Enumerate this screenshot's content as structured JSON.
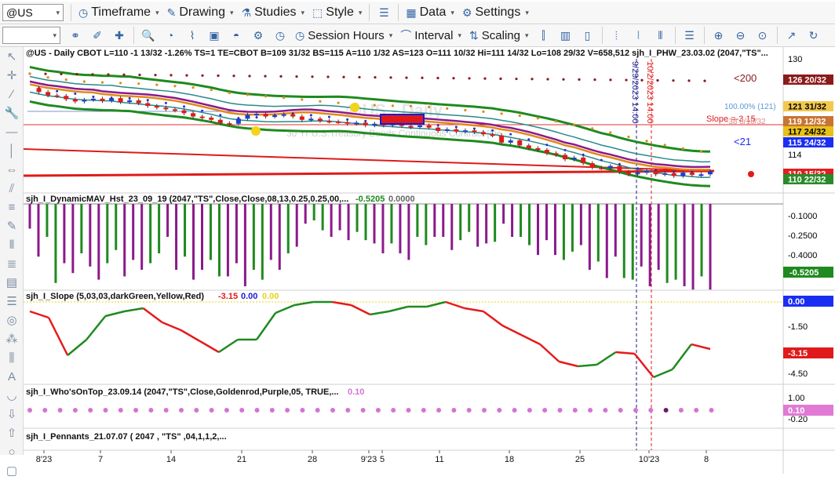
{
  "toolbar1": {
    "symbol": "@US",
    "items": [
      {
        "name": "timeframe",
        "label": "Timeframe",
        "icon": "clock-icon"
      },
      {
        "name": "drawing",
        "label": "Drawing",
        "icon": "pencil-icon"
      },
      {
        "name": "studies",
        "label": "Studies",
        "icon": "flask-icon"
      },
      {
        "name": "style",
        "label": "Style",
        "icon": "style-icon"
      },
      {
        "name": "data",
        "label": "Data",
        "icon": "data-icon"
      },
      {
        "name": "settings",
        "label": "Settings",
        "icon": "gear-icon"
      }
    ]
  },
  "toolbar2": {
    "session_label": "Session Hours",
    "interval_label": "Interval",
    "scaling_label": "Scaling"
  },
  "price_panel": {
    "header": "@US - Daily  CBOT  L=110  -1 13/32  -1.26%  TS=1  TE=CBOT  B=109 31/32  BS=115  A=110 1/32  AS=123  O=111 10/32  Hi=111 14/32  Lo=108 29/32  V=658,512  sjh_I_PHW_23.03.02 (2047,\"TS\"...",
    "watermark_symbol": "@US - Daily",
    "watermark": "30 Yr U.S.Treasury Bonds Continuous Contract [De...",
    "annot_200": "<200",
    "annot_21": "<21",
    "annot_slope": "Slope =-3.15",
    "annot_pct": "100.00% (121)",
    "annot_small": "-38 8/18/32",
    "vline1": "9/29/2023 14:00",
    "vline2": "10/2/2023 14:00",
    "axis_ticks": [
      "130",
      "114"
    ],
    "labels": [
      {
        "text": "126 20/32",
        "color": "#8b1a1a",
        "fg": "#ffffff"
      },
      {
        "text": "121 31/32",
        "color": "#f2c94c",
        "fg": "#000000"
      },
      {
        "text": "119 12/32",
        "color": "#c87533",
        "fg": "#ffffff"
      },
      {
        "text": "117 24/32",
        "color": "#e8c21a",
        "fg": "#000000"
      },
      {
        "text": "115 24/32",
        "color": "#1a2ef2",
        "fg": "#ffffff"
      },
      {
        "text": "110 15/32",
        "color": "#e02020",
        "fg": "#ffffff"
      },
      {
        "text": "110 22/32",
        "color": "#2a8a2a",
        "fg": "#ffffff"
      }
    ]
  },
  "dmav_panel": {
    "header": "sjh_I_DynamicMAV_Hst_23_09_19 (2047,\"TS\",Close,Close,08,13,0.25,0.25,00,...",
    "value1": "-0.5205",
    "value2": "0.0000",
    "axis_ticks": [
      "-0.1000",
      "-0.2500",
      "-0.4000"
    ],
    "label": "-0.5205",
    "values": [
      -0.15,
      -0.32,
      -0.2,
      -0.48,
      -0.36,
      -0.42,
      -0.3,
      -0.38,
      -0.46,
      -0.36,
      -0.28,
      -0.44,
      -0.34,
      -0.4,
      -0.36,
      -0.3,
      -0.2,
      -0.4,
      -0.32,
      -0.46,
      -0.4,
      -0.34,
      -0.44,
      -0.44,
      -0.36,
      -0.5,
      -0.4,
      -0.46,
      -0.34,
      -0.4,
      -0.3,
      -0.26,
      -0.12,
      -0.1,
      -0.16,
      -0.2,
      -0.16,
      -0.22,
      -0.17,
      -0.22,
      -0.24,
      -0.3,
      -0.24,
      -0.3,
      -0.34,
      -0.2,
      -0.25,
      -0.2,
      -0.2,
      -0.28,
      -0.22,
      -0.17,
      -0.26,
      -0.24,
      -0.23,
      -0.12,
      -0.2,
      -0.2,
      -0.25,
      -0.31,
      -0.22,
      -0.31,
      -0.34,
      -0.29,
      -0.25,
      -0.4,
      -0.35,
      -0.45,
      -0.32,
      -0.45,
      -0.46,
      -0.38,
      -0.5,
      -0.4,
      -0.48,
      -0.46,
      -0.5,
      -0.52,
      -0.44,
      -0.52
    ]
  },
  "slope_panel": {
    "header": "sjh_I_Slope (5,03,03,darkGreen,Yellow,Red)",
    "value1": "-3.15",
    "value2": "0.00",
    "value3": "0.00",
    "axis_ticks": [
      "-1.50",
      "-3.00",
      "-4.50"
    ],
    "label_top": "0.00",
    "label_val": "-3.15",
    "values": [
      -0.6,
      -1.0,
      -3.4,
      -2.4,
      -0.9,
      -0.6,
      -0.4,
      -1.3,
      -1.8,
      -2.5,
      -3.2,
      -2.4,
      -2.4,
      -0.7,
      -0.2,
      0.0,
      0.0,
      -0.2,
      -0.8,
      -0.6,
      -0.3,
      -0.3,
      0.0,
      -0.4,
      -0.6,
      -1.5,
      -2.1,
      -2.7,
      -3.8,
      -4.1,
      -4.0,
      -3.2,
      -3.3,
      -4.8,
      -4.3,
      -2.7,
      -3.0
    ]
  },
  "who_panel": {
    "header": "sjh_I_Who'sOnTop_23.09.14 (2047,\"TS\",Close,Goldenrod,Purple,05,  TRUE,...",
    "value": "0.10",
    "axis_ticks": [
      "1.00",
      "-0.20"
    ],
    "label": "0.10"
  },
  "pennants_panel": {
    "header": "sjh_I_Pennants_21.07.07 (  2047  , \"TS\" ,04,1,1,2,..."
  },
  "x_axis": [
    "8'23",
    "7",
    "14",
    "21",
    "28",
    "9'23",
    "5",
    "11",
    "18",
    "25",
    "10'23",
    "8"
  ],
  "colors": {
    "up_candle": "#1a3fd4",
    "down_candle": "#e01a1a",
    "green": "#1f8a1f",
    "purple": "#8b1a8b",
    "red": "#e61a1a",
    "teal": "#2a8a8a",
    "orange": "#e08a1a"
  },
  "price_data": {
    "closes": [
      125.3,
      124.6,
      124.0,
      123.9,
      123.3,
      122.9,
      123.2,
      123.4,
      123.0,
      123.5,
      122.8,
      123.1,
      122.6,
      122.1,
      121.8,
      121.5,
      121.3,
      120.8,
      120.2,
      120.0,
      119.6,
      119.0,
      118.9,
      119.8,
      120.5,
      120.7,
      120.2,
      120.4,
      120.6,
      120.2,
      119.6,
      119.8,
      119.4,
      119.3,
      119.2,
      118.9,
      119.1,
      118.6,
      118.9,
      118.6,
      118.9,
      118.5,
      118.3,
      118.6,
      118.2,
      117.6,
      117.9,
      117.5,
      117.7,
      117.4,
      117.0,
      116.8,
      115.5,
      115.9,
      115.0,
      114.5,
      114.2,
      113.6,
      113.3,
      112.5,
      112.8,
      111.8,
      111.0,
      110.9,
      111.3,
      110.2,
      109.8,
      110.1,
      110.4,
      109.8,
      110.0,
      109.5,
      110.1,
      109.7,
      109.8,
      110.3
    ],
    "ma200": [
      127.9,
      127.8,
      127.7,
      127.6,
      127.5,
      127.4,
      127.3,
      127.2,
      127.1,
      127.0,
      126.9,
      126.8,
      126.7,
      126.6,
      126.6
    ]
  }
}
